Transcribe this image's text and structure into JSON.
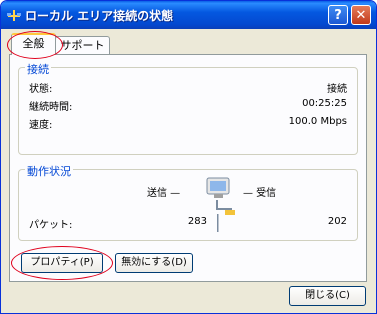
{
  "window": {
    "title": "ローカル エリア接続の状態",
    "help_label": "?",
    "close_label": "✕"
  },
  "tabs": [
    {
      "label": "全般"
    },
    {
      "label": "サポート"
    }
  ],
  "connection": {
    "legend": "接続",
    "rows": [
      {
        "label": "状態:",
        "value": "接続"
      },
      {
        "label": "継続時間:",
        "value": "00:25:25"
      },
      {
        "label": "速度:",
        "value": "100.0 Mbps"
      }
    ]
  },
  "activity": {
    "legend": "動作状況",
    "sent_label": "送信 —",
    "recv_label": "— 受信",
    "packets_label": "パケット:",
    "sent_value": "283",
    "recv_value": "202"
  },
  "buttons": {
    "properties": "プロパティ(P)",
    "disable": "無効にする(D)",
    "close": "閉じる(C)"
  },
  "colors": {
    "titlebar": "#0450d8",
    "legend": "#0046d5",
    "annotation": "#e0001c"
  }
}
